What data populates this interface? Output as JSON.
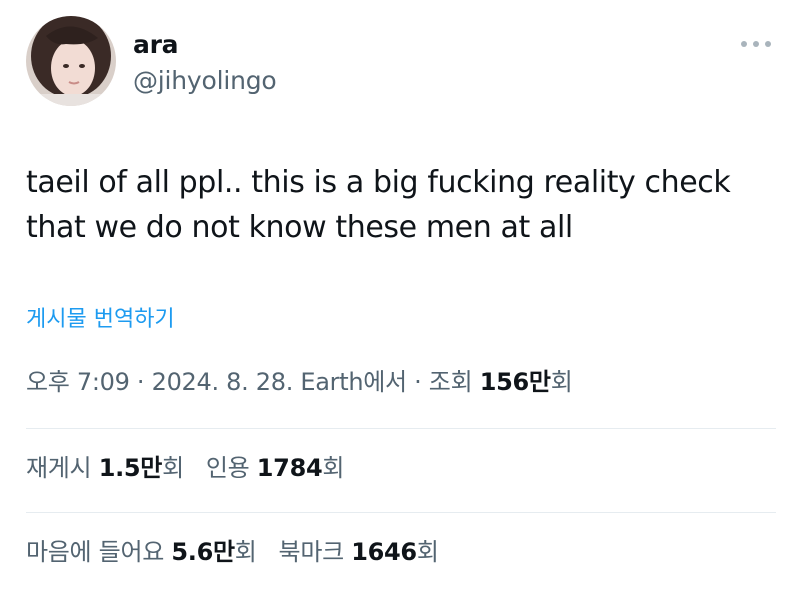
{
  "user": {
    "display_name": "ara",
    "handle": "@jihyolingo",
    "avatar_icon": "profile-photo"
  },
  "more_icon": "more-dots-icon",
  "tweet": {
    "lines": [
      "taeil of all ppl.. this is a big fucking reality check",
      "that we do not know these men at all"
    ]
  },
  "translate_label": "게시물 번역하기",
  "meta": {
    "time": "오후 7:09",
    "separator": " · ",
    "date": "2024. 8. 28.",
    "source": "Earth에서",
    "views_label": "조회",
    "views_value": "156만",
    "views_suffix": "회"
  },
  "stats_row1": [
    {
      "label": "재게시",
      "value": "1.5만",
      "suffix": "회"
    },
    {
      "label": "인용",
      "value": "1784",
      "suffix": "회"
    }
  ],
  "stats_row2": [
    {
      "label": "마음에 들어요",
      "value": "5.6만",
      "suffix": "회"
    },
    {
      "label": "북마크",
      "value": "1646",
      "suffix": "회"
    }
  ],
  "colors": {
    "text": "#0f1419",
    "secondary": "#536471",
    "link": "#1d9bf0",
    "divider": "#e6ecf0"
  }
}
